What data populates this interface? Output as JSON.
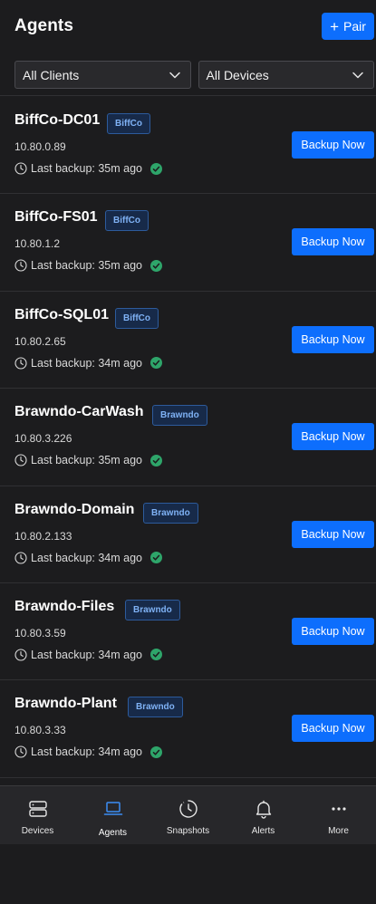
{
  "header": {
    "title": "Agents",
    "pair_label": "Pair",
    "accent": "#0d6efd"
  },
  "filters": {
    "clients": "All Clients",
    "devices": "All Devices"
  },
  "agents": [
    {
      "name": "BiffCo-DC01",
      "client": "BiffCo",
      "ip": "10.80.0.89",
      "last_backup": "Last backup: 35m ago",
      "status": "success"
    },
    {
      "name": "BiffCo-FS01",
      "client": "BiffCo",
      "ip": "10.80.1.2",
      "last_backup": "Last backup: 35m ago",
      "status": "success"
    },
    {
      "name": "BiffCo-SQL01",
      "client": "BiffCo",
      "ip": "10.80.2.65",
      "last_backup": "Last backup: 34m ago",
      "status": "success"
    },
    {
      "name": "Brawndo-CarWash",
      "client": "Brawndo",
      "ip": "10.80.3.226",
      "last_backup": "Last backup: 35m ago",
      "status": "success"
    },
    {
      "name": "Brawndo-Domain",
      "client": "Brawndo",
      "ip": "10.80.2.133",
      "last_backup": "Last backup: 34m ago",
      "status": "success"
    },
    {
      "name": "Brawndo-Files",
      "client": "Brawndo",
      "ip": "10.80.3.59",
      "last_backup": "Last backup: 34m ago",
      "status": "success"
    },
    {
      "name": "Brawndo-Plant",
      "client": "Brawndo",
      "ip": "10.80.3.33",
      "last_backup": "Last backup: 34m ago",
      "status": "success"
    }
  ],
  "backup_label": "Backup Now",
  "tabs": [
    {
      "label": "Devices",
      "icon": "server-icon"
    },
    {
      "label": "Agents",
      "icon": "laptop-icon"
    },
    {
      "label": "Snapshots",
      "icon": "history-clock-icon"
    },
    {
      "label": "Alerts",
      "icon": "bell-icon"
    },
    {
      "label": "More",
      "icon": "more-dots-icon"
    }
  ],
  "active_tab": "Agents"
}
